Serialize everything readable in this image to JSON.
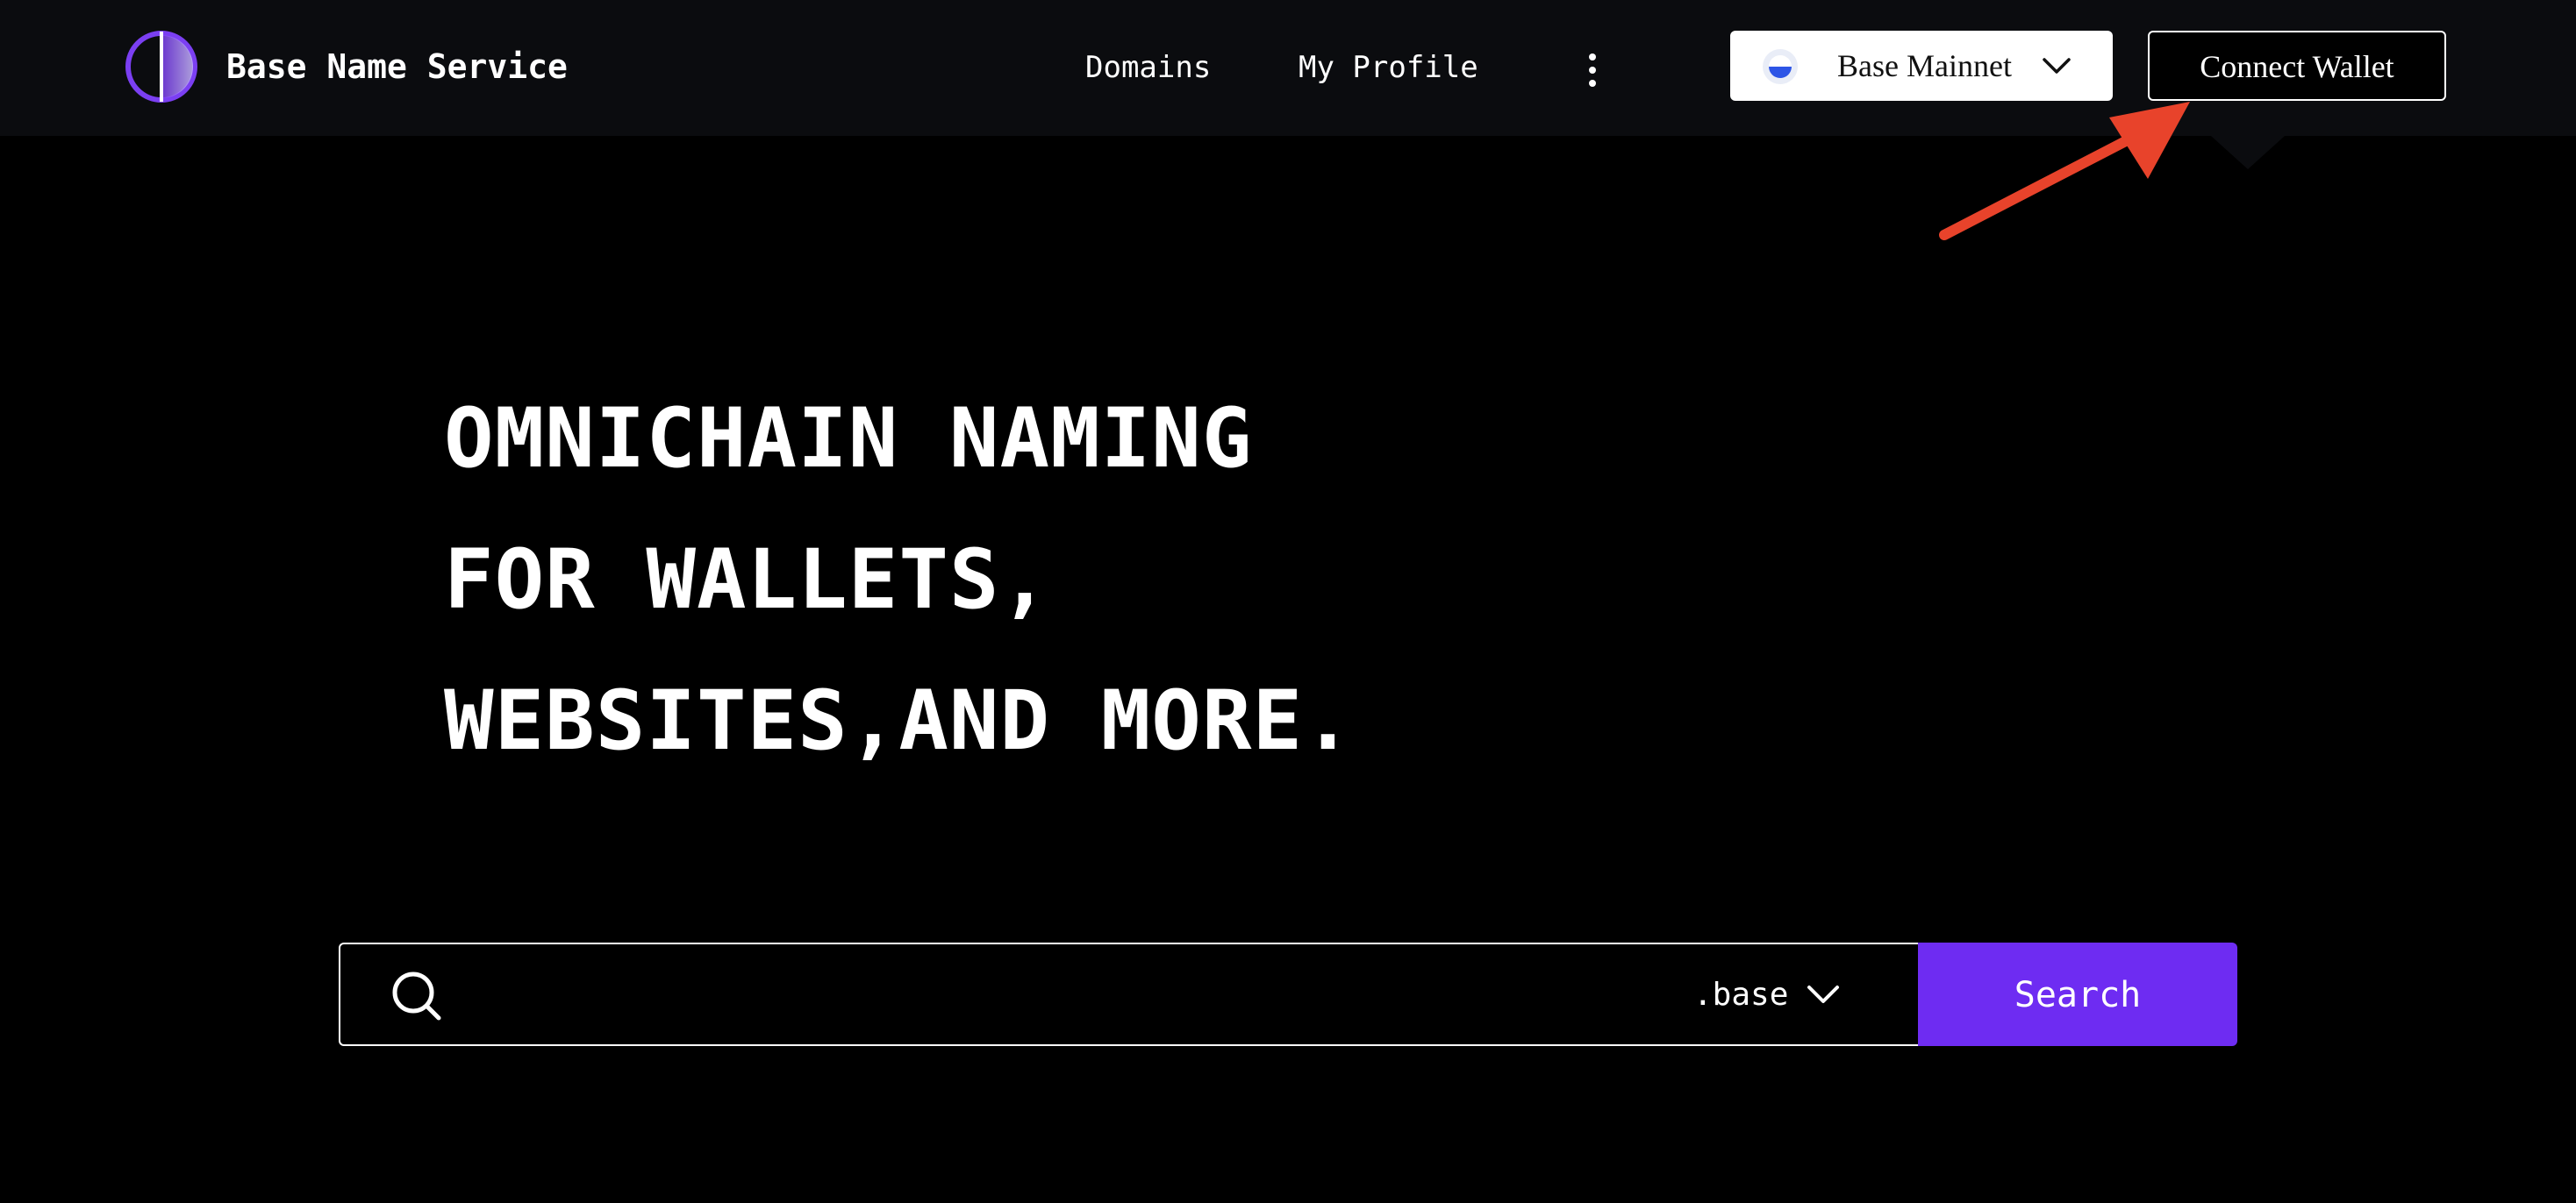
{
  "header": {
    "brand": "Base Name Service",
    "logo_icon": "half-circle-logo-icon",
    "nav": {
      "domains": "Domains",
      "my_profile": "My Profile",
      "more_icon": "kebab-menu-icon"
    },
    "network": {
      "selected": "Base Mainnet",
      "icon": "base-network-icon",
      "chevron_icon": "chevron-down-icon"
    },
    "connect_wallet": "Connect Wallet"
  },
  "annotation": {
    "arrow_icon": "red-arrow-icon",
    "color": "#e8432b"
  },
  "hero": {
    "line1": "OMNICHAIN NAMING",
    "line2": "FOR WALLETS,",
    "line3": "WEBSITES,AND MORE."
  },
  "search": {
    "placeholder": "",
    "value": "",
    "search_icon": "search-icon",
    "tld": ".base",
    "tld_chevron_icon": "chevron-down-icon",
    "button_label": "Search"
  },
  "colors": {
    "background": "#000000",
    "navbar": "#0b0c0f",
    "accent": "#6e2cf2",
    "text": "#ffffff"
  }
}
